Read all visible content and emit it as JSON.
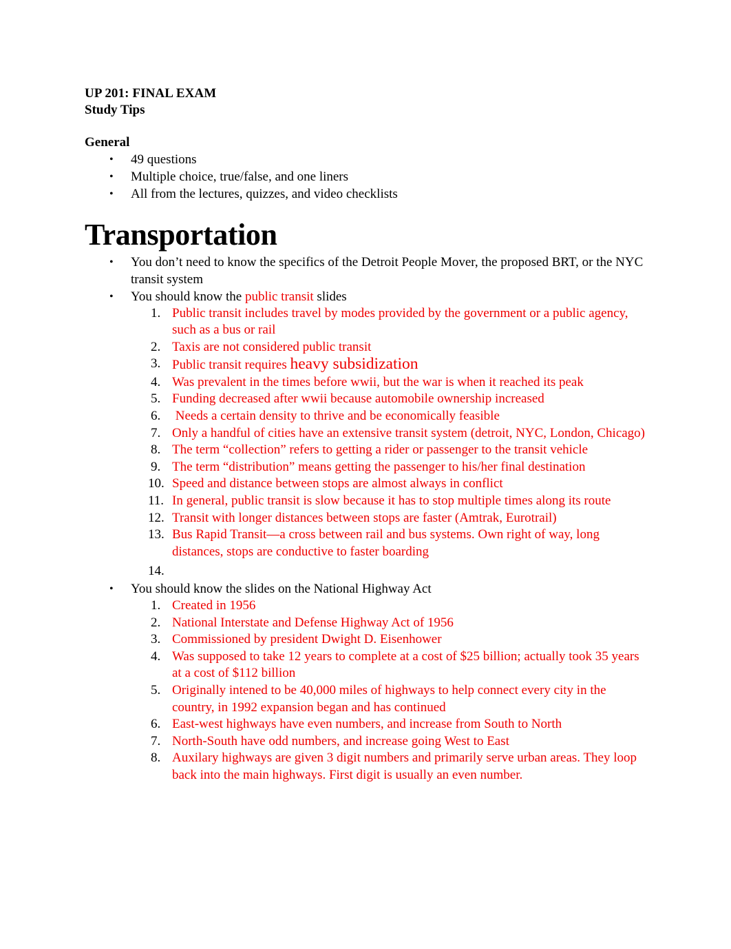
{
  "document": {
    "title": "UP 201: FINAL EXAM",
    "subtitle": "Study Tips",
    "colors": {
      "text": "#000000",
      "highlight": "#EE0000",
      "background": "#FFFFFF"
    }
  },
  "general": {
    "heading": "General",
    "bullet_glyph": "•",
    "items": [
      "49 questions",
      "Multiple choice, true/false, and one liners",
      "All from the lectures, quizzes, and video checklists"
    ]
  },
  "transportation": {
    "heading": "Transportation",
    "bullet_glyph": "•",
    "bullet_1": {
      "text": "You don’t need to know the specifics of the Detroit People Mover, the proposed BRT, or the NYC transit system"
    },
    "bullet_2": {
      "text_before": "You should know the ",
      "highlight": "public transit",
      "text_after": " slides",
      "items": [
        {
          "n": "1.",
          "text": "Public transit includes travel by modes provided by the government or a public agency, such as a bus or rail"
        },
        {
          "n": "2.",
          "text": "Taxis are not considered public transit"
        },
        {
          "n": "3.",
          "text_small": "Public transit requires ",
          "text_large": "heavy subsidization"
        },
        {
          "n": "4.",
          "text": "Was prevalent in the times before wwii, but the war is when it reached its peak"
        },
        {
          "n": "5.",
          "text": "Funding decreased after wwii because automobile ownership increased",
          "size": "large"
        },
        {
          "n": "6.",
          "text": " Needs a certain density to thrive and be economically feasible"
        },
        {
          "n": "7.",
          "text": "Only a handful of cities have an extensive transit system (detroit, NYC, London, Chicago)"
        },
        {
          "n": "8.",
          "text": "The term “collection” refers to getting a rider or passenger to the transit vehicle"
        },
        {
          "n": "9.",
          "text": "The term “distribution” means getting the passenger to his/her final destination"
        },
        {
          "n": "10.",
          "text": "Speed and distance between stops are almost always in conflict"
        },
        {
          "n": "11.",
          "text": "In general, public transit is slow because it has to stop multiple times along its route"
        },
        {
          "n": "12.",
          "text": "Transit with longer distances between stops are faster (Amtrak, Eurotrail)"
        },
        {
          "n": "13.",
          "text": "Bus Rapid Transit—a cross between rail and bus systems. Own right of way, long distances, stops are conductive to faster boarding"
        },
        {
          "n": "14.",
          "text": ""
        }
      ]
    },
    "bullet_3": {
      "text": "You should know the slides on the National Highway Act",
      "items": [
        {
          "n": "1.",
          "text": "Created in 1956"
        },
        {
          "n": "2.",
          "text": "National Interstate and Defense Highway Act of 1956"
        },
        {
          "n": "3.",
          "text": "Commissioned by president Dwight D. Eisenhower"
        },
        {
          "n": "4.",
          "text": "Was supposed to take 12 years to complete at a cost of $25 billion; actually took 35 years at a cost of $112 billion"
        },
        {
          "n": "5.",
          "text": "Originally intened to be 40,000 miles of highways to help connect every city in the country, in 1992 expansion began and has continued"
        },
        {
          "n": "6.",
          "text": "East-west highways have even numbers, and increase from South to North"
        },
        {
          "n": "7.",
          "text": "North-South have odd numbers, and increase going West to East"
        },
        {
          "n": "8.",
          "text": "Auxilary highways are given 3 digit numbers and primarily serve urban areas. They loop back into the main highways. First digit is usually an even number."
        }
      ]
    }
  }
}
